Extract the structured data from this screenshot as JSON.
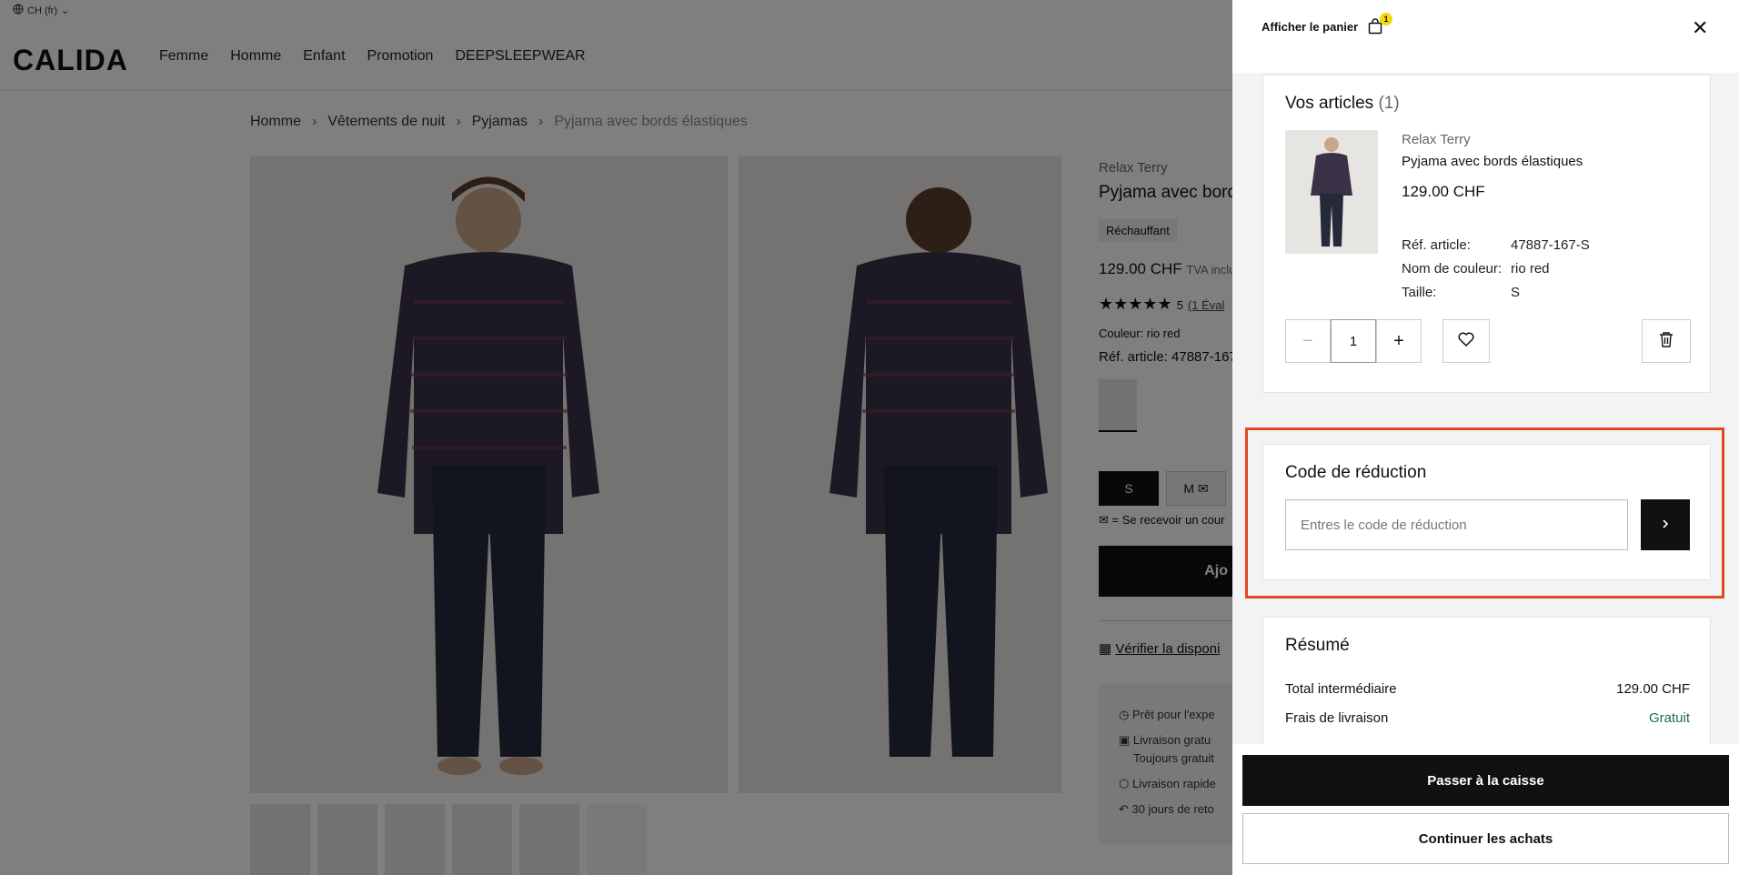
{
  "locale": "CH (fr)",
  "logo": "CALIDA",
  "nav": [
    "Femme",
    "Homme",
    "Enfant",
    "Promotion",
    "DEEPSLEEPWEAR"
  ],
  "breadcrumb": [
    "Homme",
    "Vêtements de nuit",
    "Pyjamas",
    "Pyjama avec bords élastiques"
  ],
  "product": {
    "brand": "Relax Terry",
    "name": "Pyjama avec bords élastiques",
    "tag": "Réchauffant",
    "price": "129.00 CHF",
    "tax_note": "TVA inclu",
    "rating": "5",
    "reviews_link": "(1 Éval",
    "color": "Couleur: rio red",
    "ref": "Réf. article: 47887-167",
    "sizes": [
      "S",
      "M"
    ],
    "notify": "= Se recevoir un cour",
    "add_label": "Ajo",
    "verify": "Vérifier la disponi",
    "perks": [
      "Prêt pour l'expe",
      "Livraison gratu",
      "Toujours gratuit",
      "Livraison rapide",
      "30 jours de reto"
    ]
  },
  "cart": {
    "title": "Afficher le panier",
    "badge": "1",
    "items_heading": "Vos articles",
    "items_count": "(1)",
    "item": {
      "brand": "Relax Terry",
      "name": "Pyjama avec bords élastiques",
      "price": "129.00 CHF",
      "ref_label": "Réf. article:",
      "ref_value": "47887-167-S",
      "color_label": "Nom de couleur:",
      "color_value": "rio red",
      "size_label": "Taille:",
      "size_value": "S",
      "quantity": "1"
    },
    "promo": {
      "heading": "Code de réduction",
      "placeholder": "Entres le code de réduction"
    },
    "summary": {
      "heading": "Résumé",
      "subtotal_label": "Total intermédiaire",
      "subtotal_value": "129.00 CHF",
      "shipping_label": "Frais de livraison",
      "shipping_value": "Gratuit"
    },
    "checkout_label": "Passer à la caisse",
    "continue_label": "Continuer les achats"
  },
  "colors": {
    "accent": "#111111",
    "highlight": "#e2491c",
    "free": "#1f6b4a",
    "badge": "#f5d90a"
  }
}
